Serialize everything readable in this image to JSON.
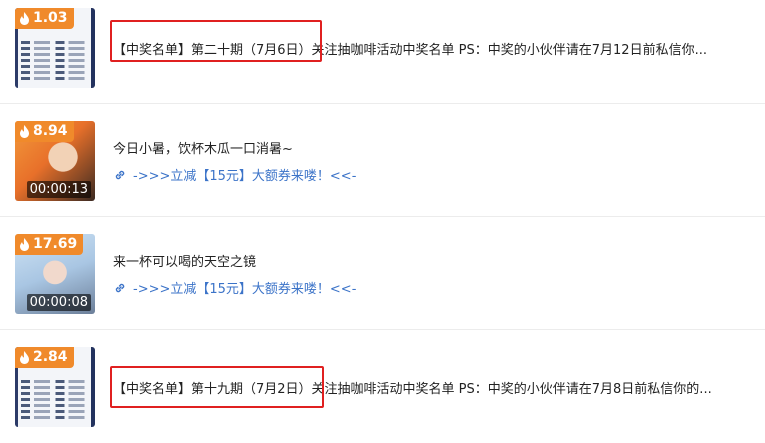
{
  "items": [
    {
      "heat": "1.03",
      "title": "【中奖名单】第二十期（7月6日）关注抽咖啡活动中奖名单 PS：中奖的小伙伴请在7月12日前私信你...",
      "thumb": "winner-list-image"
    },
    {
      "heat": "8.94",
      "title": "今日小暑，饮杯木瓜一口消暑~",
      "link": "->>>立减【15元】大额券来喽！<<-",
      "duration": "00:00:13",
      "thumb": "video-thumbnail"
    },
    {
      "heat": "17.69",
      "title": "来一杯可以喝的天空之镜",
      "link": "->>>立减【15元】大额券来喽！<<-",
      "duration": "00:00:08",
      "thumb": "video-thumbnail"
    },
    {
      "heat": "2.84",
      "title": "【中奖名单】第十九期（7月2日）关注抽咖啡活动中奖名单 PS：中奖的小伙伴请在7月8日前私信你的...",
      "thumb": "winner-list-image"
    }
  ],
  "colors": {
    "accent": "#f08a2b",
    "link": "#3b73c8",
    "highlight": "#e02020"
  },
  "icons": {
    "heat": "flame-icon",
    "link": "link-icon"
  }
}
